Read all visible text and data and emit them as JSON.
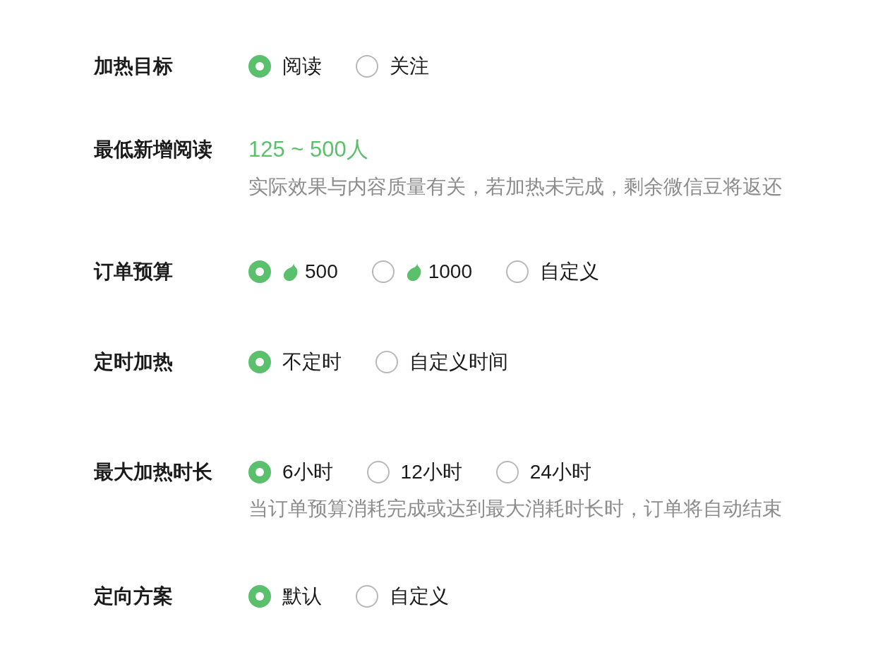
{
  "form": {
    "rows": [
      {
        "label": "加热目标",
        "kind": "choice",
        "options": [
          {
            "label": "阅读",
            "selected": true
          },
          {
            "label": "关注",
            "selected": false
          }
        ]
      },
      {
        "label": "最低新增阅读",
        "kind": "range",
        "value": "125 ~ 500人",
        "note": "实际效果与内容质量有关，若加热未完成，剩余微信豆将返还"
      },
      {
        "label": "订单预算",
        "kind": "choice",
        "options": [
          {
            "label": "500",
            "selected": true,
            "kind": "amount"
          },
          {
            "label": "1000",
            "selected": false,
            "kind": "amount"
          },
          {
            "label": "自定义",
            "selected": false,
            "kind": "text"
          }
        ]
      },
      {
        "label": "定时加热",
        "kind": "choice",
        "options": [
          {
            "label": "不定时",
            "selected": true
          },
          {
            "label": "自定义时间",
            "selected": false
          }
        ]
      },
      {
        "label": "最大加热时长",
        "kind": "choice",
        "options": [
          {
            "label": "6小时",
            "selected": true
          },
          {
            "label": "12小时",
            "selected": false
          },
          {
            "label": "24小时",
            "selected": false
          }
        ],
        "note": "当订单预算消耗完成或达到最大消耗时长时，订单将自动结束"
      },
      {
        "label": "定向方案",
        "kind": "choice",
        "options": [
          {
            "label": "默认",
            "selected": true
          },
          {
            "label": "自定义",
            "selected": false
          }
        ]
      }
    ]
  }
}
